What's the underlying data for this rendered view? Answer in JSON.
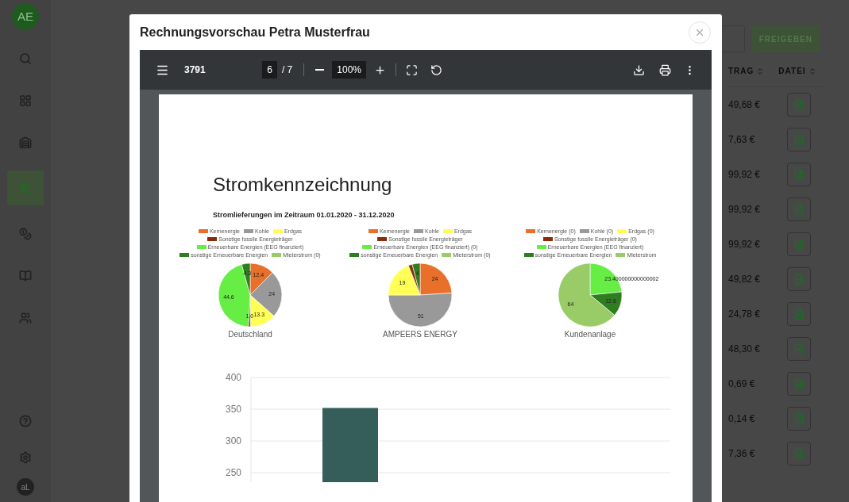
{
  "sidebar": {
    "logo": "AE",
    "items": [
      {
        "selected": false
      },
      {
        "selected": false
      },
      {
        "selected": false
      },
      {
        "selected": true
      },
      {
        "selected": false
      },
      {
        "selected": false
      },
      {
        "selected": false
      }
    ],
    "avatar": "aL"
  },
  "background": {
    "release_button": "FREIGEBEN",
    "columns": [
      {
        "label": "TRAG"
      },
      {
        "label": "DATEI"
      }
    ],
    "amounts": [
      "49,68 €",
      "7,63 €",
      "99,92 €",
      "99,92 €",
      "99,92 €",
      "49,82 €",
      "24,78 €",
      "48,30 €",
      "0,69 €",
      "0,14 €",
      "7,36 €"
    ]
  },
  "modal": {
    "title": "Rechnungsvorschau Petra Musterfrau",
    "viewer": {
      "file": "3791",
      "page": "6",
      "page_total": "/ 7",
      "zoom": "100%"
    },
    "document": {
      "heading": "Stromkennzeichnung",
      "subheading": "Stromlieferungen im Zeitraum 01.01.2020 - 31.12.2020",
      "pies": [
        {
          "chart_data": {
            "type": "pie",
            "title": "Deutschland",
            "legend": "top",
            "categories": [
              "Kernenergie",
              "Kohle",
              "Erdgas",
              "Sonstige fossile Energieträger",
              "Erneuerbare Energien (EEG finanziert)",
              "sonstige Erneuerbare Energien",
              "Mieterstrom (0)"
            ],
            "values": [
              12.4,
              24,
              13.3,
              1,
              44.6,
              4.3,
              0
            ],
            "colors": [
              "#e8702a",
              "#999999",
              "#ffff55",
              "#8b2c0a",
              "#66ee44",
              "#2e7d1f",
              "#99cc66"
            ],
            "value_labels": [
              "12.4",
              "24",
              "13.3",
              "1.0",
              "44.6",
              "4.3",
              null
            ]
          }
        },
        {
          "chart_data": {
            "type": "pie",
            "title": "AMPEERS ENERGY",
            "legend": "top",
            "categories": [
              "Kernenergie",
              "Kohle",
              "Erdgas",
              "Sonstige fossile Energieträger",
              "Erneuerbare Energien (EEG finanziert) (0)",
              "sonstige Erneuerbare Energien",
              "Mieterstrom (0)"
            ],
            "values": [
              24,
              51,
              19,
              2,
              0,
              4,
              0
            ],
            "colors": [
              "#e8702a",
              "#999999",
              "#ffff55",
              "#8b2c0a",
              "#66ee44",
              "#2e7d1f",
              "#99cc66"
            ],
            "value_labels": [
              "24",
              "51",
              "19",
              null,
              null,
              "4",
              null
            ]
          }
        },
        {
          "chart_data": {
            "type": "pie",
            "title": "Kundenanlage",
            "legend": "top",
            "categories": [
              "Kernenergie (0)",
              "Kohle (0)",
              "Erdgas (0)",
              "Sonstige fossile Energieträger (0)",
              "Erneuerbare Energien (EEG finanziert)",
              "sonstige Erneuerbare Energien",
              "Mieterstrom"
            ],
            "values": [
              0,
              0,
              0,
              0,
              23.4,
              12.6,
              64
            ],
            "colors": [
              "#e8702a",
              "#999999",
              "#ffff55",
              "#8b2c0a",
              "#66ee44",
              "#2e7d1f",
              "#99cc66"
            ],
            "value_labels": [
              null,
              null,
              null,
              null,
              "23.400000000000002",
              "12.6",
              "64"
            ]
          }
        }
      ],
      "bar_chart": {
        "chart_data": {
          "type": "bar",
          "series": [
            {
              "color": "#355e5b",
              "values": [
                352
              ]
            }
          ],
          "ylim": [
            250,
            400
          ],
          "yticks": [
            250,
            300,
            350,
            400
          ]
        }
      }
    }
  }
}
